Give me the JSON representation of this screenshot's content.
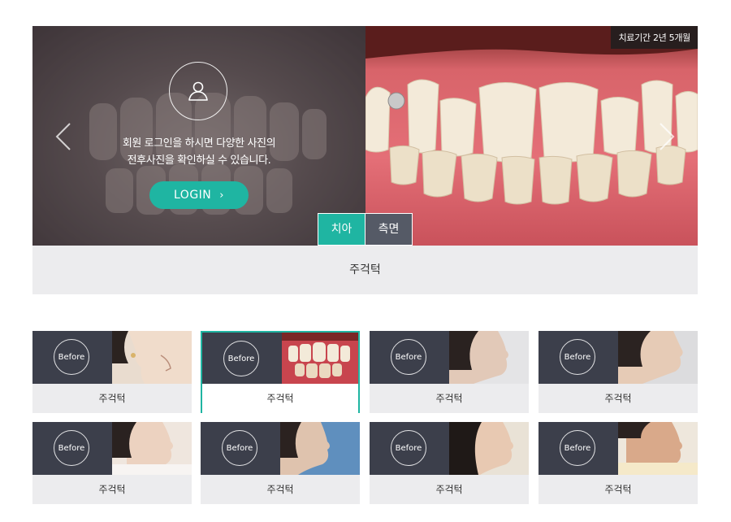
{
  "hero": {
    "duration_badge": "치료기간 2년 5개월",
    "login_message_line1": "회원 로그인을 하시면 다양한 사진의",
    "login_message_line2": "전후사진을 확인하실 수 있습니다.",
    "login_button": "LOGIN",
    "login_button_icon": "chevron-right-icon",
    "prev_icon": "chevron-left-icon",
    "next_icon": "chevron-right-icon",
    "avatar_icon": "user-icon",
    "tabs": [
      {
        "label": "치아",
        "active": true
      },
      {
        "label": "측면",
        "active": false
      }
    ],
    "caption": "주걱턱"
  },
  "thumbnails": [
    {
      "before_label": "Before",
      "label": "주걱턱",
      "selected": false,
      "photo": "profile"
    },
    {
      "before_label": "Before",
      "label": "주걱턱",
      "selected": true,
      "photo": "teeth"
    },
    {
      "before_label": "Before",
      "label": "주걱턱",
      "selected": false,
      "photo": "profile"
    },
    {
      "before_label": "Before",
      "label": "주걱턱",
      "selected": false,
      "photo": "profile"
    },
    {
      "before_label": "Before",
      "label": "주걱턱",
      "selected": false,
      "photo": "profile"
    },
    {
      "before_label": "Before",
      "label": "주걱턱",
      "selected": false,
      "photo": "profile"
    },
    {
      "before_label": "Before",
      "label": "주걱턱",
      "selected": false,
      "photo": "profile"
    },
    {
      "before_label": "Before",
      "label": "주걱턱",
      "selected": false,
      "photo": "profile"
    }
  ],
  "colors": {
    "accent": "#1fb5a2",
    "tab_inactive": "#555a66",
    "caption_bg": "#ececee",
    "before_bg": "#3c3f4b"
  }
}
